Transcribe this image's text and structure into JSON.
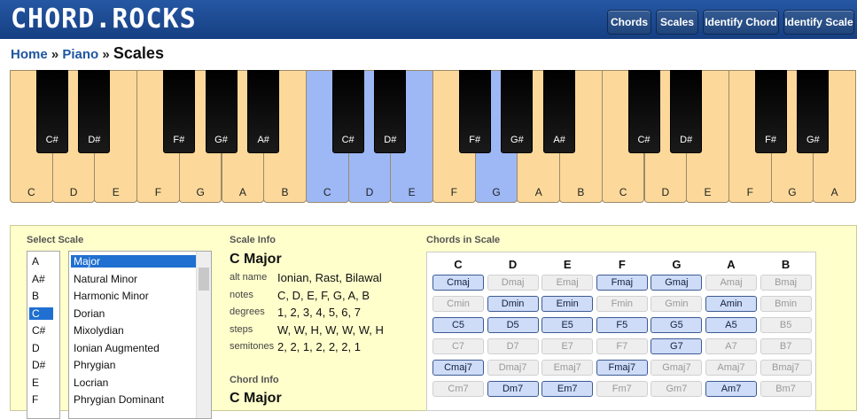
{
  "header": {
    "logo": "CHORD.ROCKS",
    "nav": [
      "Chords",
      "Scales",
      "Identify Chord",
      "Identify Scale"
    ]
  },
  "breadcrumb": {
    "home": "Home",
    "sep": "»",
    "piano": "Piano",
    "current": "Scales"
  },
  "piano": {
    "white_keys": [
      {
        "label": "C",
        "hl": false
      },
      {
        "label": "D",
        "hl": false
      },
      {
        "label": "E",
        "hl": false
      },
      {
        "label": "F",
        "hl": false
      },
      {
        "label": "G",
        "hl": false
      },
      {
        "label": "A",
        "hl": false
      },
      {
        "label": "B",
        "hl": false
      },
      {
        "label": "C",
        "hl": true
      },
      {
        "label": "D",
        "hl": true
      },
      {
        "label": "E",
        "hl": true
      },
      {
        "label": "F",
        "hl": false
      },
      {
        "label": "G",
        "hl": true
      },
      {
        "label": "A",
        "hl": false
      },
      {
        "label": "B",
        "hl": false
      },
      {
        "label": "C",
        "hl": false
      },
      {
        "label": "D",
        "hl": false
      },
      {
        "label": "E",
        "hl": false
      },
      {
        "label": "F",
        "hl": false
      },
      {
        "label": "G",
        "hl": false
      },
      {
        "label": "A",
        "hl": false
      }
    ],
    "black_keys": [
      "C#",
      "D#",
      "F#",
      "G#",
      "A#",
      "C#",
      "D#",
      "F#",
      "G#",
      "A#",
      "C#",
      "D#",
      "F#",
      "G#"
    ]
  },
  "select_scale": {
    "title": "Select Scale",
    "roots": [
      "A",
      "A#",
      "B",
      "C",
      "C#",
      "D",
      "D#",
      "E",
      "F"
    ],
    "selected_root": "C",
    "scales": [
      "Major",
      "Natural Minor",
      "Harmonic Minor",
      "Dorian",
      "Mixolydian",
      "Ionian Augmented",
      "Phrygian",
      "Locrian",
      "Phrygian Dominant"
    ],
    "selected_scale": "Major"
  },
  "scale_info": {
    "title": "Scale Info",
    "name": "C Major",
    "rows": [
      {
        "label": "alt name",
        "value": "Ionian, Rast, Bilawal"
      },
      {
        "label": "notes",
        "value": "C, D, E, F, G, A, B"
      },
      {
        "label": "degrees",
        "value": "1, 2, 3, 4, 5, 6, 7"
      },
      {
        "label": "steps",
        "value": "W, W, H, W, W, W, H"
      },
      {
        "label": "semitones",
        "value": "2, 2, 1, 2, 2, 2, 1"
      }
    ]
  },
  "chord_info": {
    "title": "Chord Info",
    "name": "C Major"
  },
  "chords_in_scale": {
    "title": "Chords in Scale",
    "columns": [
      "C",
      "D",
      "E",
      "F",
      "G",
      "A",
      "B"
    ],
    "rows": [
      [
        {
          "t": "Cmaj",
          "on": true
        },
        {
          "t": "Dmaj",
          "on": false
        },
        {
          "t": "Emaj",
          "on": false
        },
        {
          "t": "Fmaj",
          "on": true
        },
        {
          "t": "Gmaj",
          "on": true
        },
        {
          "t": "Amaj",
          "on": false
        },
        {
          "t": "Bmaj",
          "on": false
        }
      ],
      [
        {
          "t": "Cmin",
          "on": false
        },
        {
          "t": "Dmin",
          "on": true
        },
        {
          "t": "Emin",
          "on": true
        },
        {
          "t": "Fmin",
          "on": false
        },
        {
          "t": "Gmin",
          "on": false
        },
        {
          "t": "Amin",
          "on": true
        },
        {
          "t": "Bmin",
          "on": false
        }
      ],
      [
        {
          "t": "C5",
          "on": true
        },
        {
          "t": "D5",
          "on": true
        },
        {
          "t": "E5",
          "on": true
        },
        {
          "t": "F5",
          "on": true
        },
        {
          "t": "G5",
          "on": true
        },
        {
          "t": "A5",
          "on": true
        },
        {
          "t": "B5",
          "on": false
        }
      ],
      [
        {
          "t": "C7",
          "on": false
        },
        {
          "t": "D7",
          "on": false
        },
        {
          "t": "E7",
          "on": false
        },
        {
          "t": "F7",
          "on": false
        },
        {
          "t": "G7",
          "on": true
        },
        {
          "t": "A7",
          "on": false
        },
        {
          "t": "B7",
          "on": false
        }
      ],
      [
        {
          "t": "Cmaj7",
          "on": true
        },
        {
          "t": "Dmaj7",
          "on": false
        },
        {
          "t": "Emaj7",
          "on": false
        },
        {
          "t": "Fmaj7",
          "on": true
        },
        {
          "t": "Gmaj7",
          "on": false
        },
        {
          "t": "Amaj7",
          "on": false
        },
        {
          "t": "Bmaj7",
          "on": false
        }
      ],
      [
        {
          "t": "Cm7",
          "on": false
        },
        {
          "t": "Dm7",
          "on": true
        },
        {
          "t": "Em7",
          "on": true
        },
        {
          "t": "Fm7",
          "on": false
        },
        {
          "t": "Gm7",
          "on": false
        },
        {
          "t": "Am7",
          "on": true
        },
        {
          "t": "Bm7",
          "on": false
        }
      ]
    ]
  }
}
